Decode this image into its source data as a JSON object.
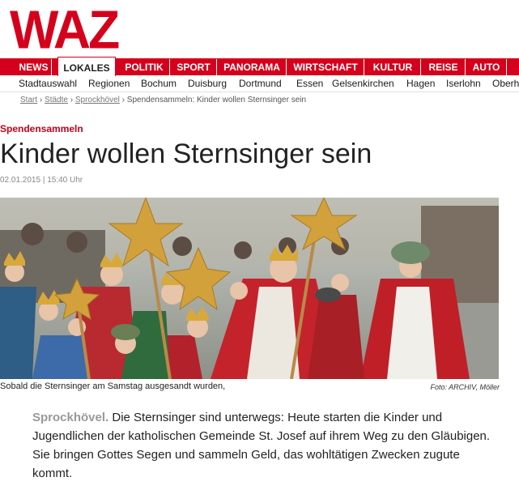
{
  "brand": {
    "logo_text": "WAZ",
    "accent_color": "#d5001c"
  },
  "main_nav": [
    {
      "label": "NEWS",
      "active": false
    },
    {
      "label": "LOKALES",
      "active": true
    },
    {
      "label": "POLITIK",
      "active": false
    },
    {
      "label": "SPORT",
      "active": false
    },
    {
      "label": "PANORAMA",
      "active": false
    },
    {
      "label": "WIRTSCHAFT",
      "active": false
    },
    {
      "label": "KULTUR",
      "active": false
    },
    {
      "label": "REISE",
      "active": false
    },
    {
      "label": "AUTO",
      "active": false
    }
  ],
  "sub_nav": [
    "Stadtauswahl",
    "Regionen",
    "Bochum",
    "Duisburg",
    "Dortmund",
    "Essen",
    "Gelsenkirchen",
    "Hagen",
    "Iserlohn",
    "Oberh"
  ],
  "breadcrumb": {
    "items": [
      "Start",
      "Städte",
      "Sprockhövel"
    ],
    "separator": "›",
    "current": "Spendensammeln: Kinder wollen Sternsinger sein"
  },
  "article": {
    "kicker": "Spendensammeln",
    "headline": "Kinder wollen Sternsinger sein",
    "dateline": "02.01.2015 | 15:40 Uhr",
    "photo": {
      "caption": "Sobald die Sternsinger am Samstag ausgesandt wurden,",
      "credit": "Foto: ARCHIV, Möller"
    },
    "teaser_location": "Sprockhövel.",
    "teaser_text": " Die Sternsinger sind unterwegs: Heute starten die Kinder und Jugendlichen der katholischen Gemeinde St. Josef auf ihrem Weg zu den Gläubigen. Sie bringen Gottes Segen und sammeln Geld, das wohltätigen Zwecken zugute kommt."
  }
}
